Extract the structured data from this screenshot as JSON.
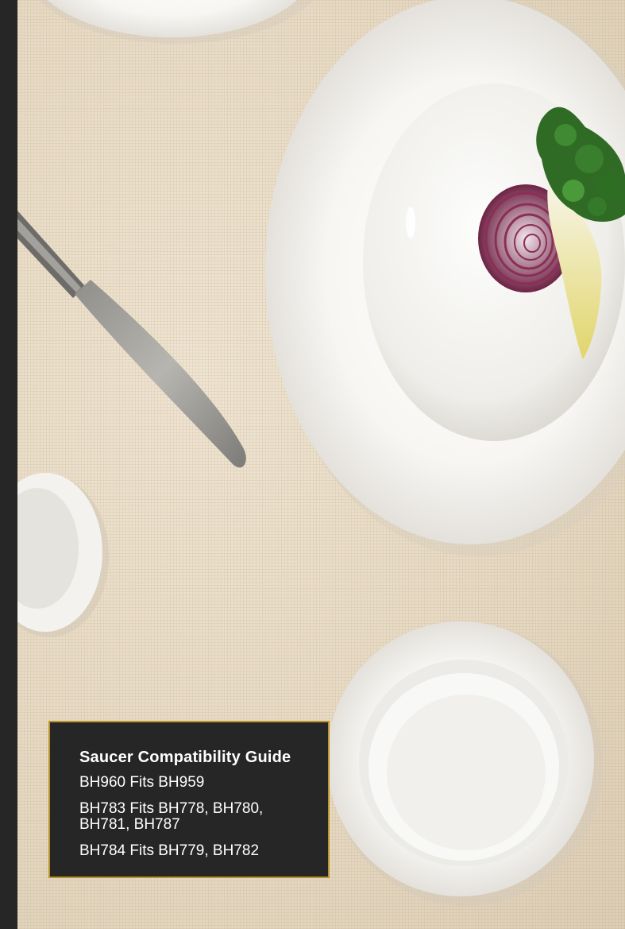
{
  "photo": {
    "description_icons": [
      "pasta-plate-icon",
      "knife-icon",
      "side-bowl-icon",
      "bowl-on-saucer-icon",
      "red-onion-icon",
      "kale-icon"
    ]
  },
  "guide": {
    "title": "Saucer Compatibility Guide",
    "lines": [
      "BH960 Fits BH959",
      "BH783 Fits BH778, BH780,\nBH781, BH787",
      "BH784 Fits BH779, BH782"
    ],
    "line1": "BH960 Fits BH959",
    "line2a": "BH783 Fits BH778, BH780,",
    "line2b": "BH781, BH787",
    "line3": "BH784 Fits BH779, BH782"
  },
  "colors": {
    "background": "#262626",
    "accent_border": "#b9952c",
    "tablecloth": "#e9dcc7"
  }
}
